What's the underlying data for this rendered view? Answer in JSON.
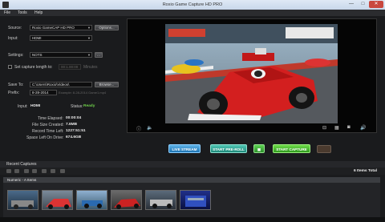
{
  "window": {
    "title": "Roxio Game Capture HD PRO",
    "min": "—",
    "max": "□",
    "close": "✕"
  },
  "menu": [
    "File",
    "Tools",
    "Help"
  ],
  "settings": {
    "source_label": "Source:",
    "source_value": "Roxio GameCAP HD PRO",
    "options_label": "Options...",
    "input_label": "Input:",
    "input_value": "HDMI",
    "settings_label": "Settings:",
    "settings_value": "NOTS",
    "capture_length_label": "Set capture length to:",
    "capture_length_value": "00:1.00:00",
    "capture_length_unit": "Minutes",
    "save_to_label": "Save To:",
    "save_to_value": "C:\\Users\\Roxio\\Videos\\",
    "browse_label": "Browse...",
    "prefix_label": "Prefix:",
    "prefix_value": "8-28-2014",
    "prefix_example": "Example: 8-28-2014 Game1.mp4"
  },
  "status": {
    "input_label": "Input:",
    "input_value": "HDMI",
    "status_label": "Status:",
    "status_value": "Ready",
    "time_elapsed_label": "Time Elapsed:",
    "time_elapsed_value": "00:00:04",
    "file_size_label": "File Size Created:",
    "file_size_value": "7.6MB",
    "record_time_label": "Record Time Left:",
    "record_time_value": "1227:51:51",
    "space_left_label": "Space Left On Drive:",
    "space_left_value": "674.6GB"
  },
  "actions": {
    "live": "LIVE STREAM",
    "preroll": "START PRE-ROLL",
    "capture": "START CAPTURE"
  },
  "recent": {
    "header": "Recent Captures",
    "items_total": "6 Items Total",
    "group_title": "Numeric - A Items"
  },
  "colors": {
    "accent_live": "#1d74b4",
    "accent_preroll": "#1d8a7a",
    "accent_capture": "#2f9a1e",
    "status_ready": "#6fd14a"
  }
}
